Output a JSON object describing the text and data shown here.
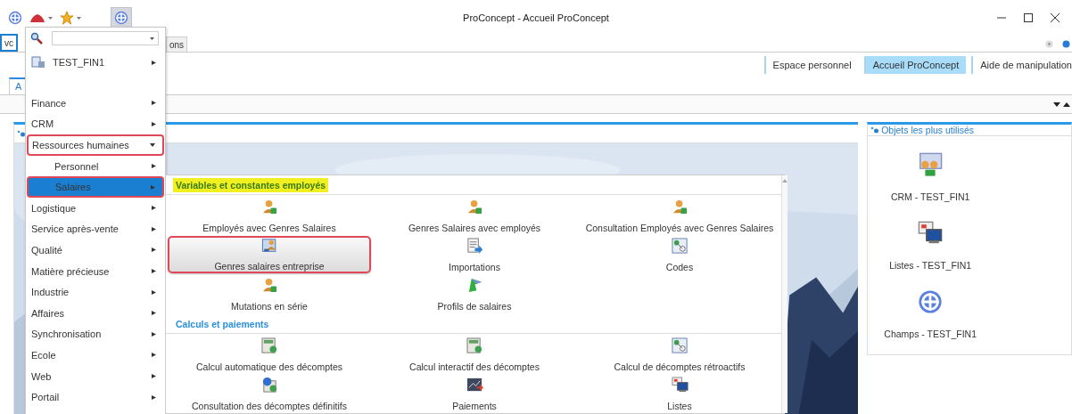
{
  "window": {
    "title": "ProConcept - Accueil ProConcept"
  },
  "document_tabs": [
    {
      "label": "vc",
      "selected": true
    },
    {
      "label": "ons",
      "selected": false
    }
  ],
  "nav_tabs": [
    {
      "label": "Espace personnel",
      "selected": false
    },
    {
      "label": "Accueil ProConcept",
      "selected": true
    },
    {
      "label": "Aide de manipulation",
      "selected": false
    }
  ],
  "page_tabs": [
    {
      "label": "A",
      "selected": true
    }
  ],
  "menu": {
    "workspace": {
      "label": "TEST_FIN1"
    },
    "items": [
      {
        "label": "Finance",
        "expanded": false,
        "selected": false,
        "outlined": false
      },
      {
        "label": "CRM",
        "expanded": false,
        "selected": false,
        "outlined": false
      },
      {
        "label": "Ressources humaines",
        "expanded": true,
        "selected": false,
        "outlined": true,
        "children": [
          {
            "label": "Personnel",
            "expanded": false,
            "selected": false,
            "outlined": false
          },
          {
            "label": "Salaires",
            "expanded": false,
            "selected": true,
            "outlined": true
          }
        ]
      },
      {
        "label": "Logistique",
        "expanded": false,
        "selected": false,
        "outlined": false
      },
      {
        "label": "Service après-vente",
        "expanded": false,
        "selected": false,
        "outlined": false
      },
      {
        "label": "Qualité",
        "expanded": false,
        "selected": false,
        "outlined": false
      },
      {
        "label": "Matière précieuse",
        "expanded": false,
        "selected": false,
        "outlined": false
      },
      {
        "label": "Industrie",
        "expanded": false,
        "selected": false,
        "outlined": false
      },
      {
        "label": "Affaires",
        "expanded": false,
        "selected": false,
        "outlined": false
      },
      {
        "label": "Synchronisation",
        "expanded": false,
        "selected": false,
        "outlined": false
      },
      {
        "label": "Ecole",
        "expanded": false,
        "selected": false,
        "outlined": false
      },
      {
        "label": "Web",
        "expanded": false,
        "selected": false,
        "outlined": false
      },
      {
        "label": "Portail",
        "expanded": false,
        "selected": false,
        "outlined": false
      }
    ]
  },
  "flyout": {
    "sections": [
      {
        "title": "Variables et constantes employés",
        "highlighted": true,
        "items": [
          {
            "label": "Employés avec Genres Salaires",
            "outlined": false
          },
          {
            "label": "Genres Salaires avec employés",
            "outlined": false
          },
          {
            "label": "Consultation Employés avec Genres Salaires",
            "outlined": false
          },
          {
            "label": "Genres salaires entreprise",
            "outlined": true
          },
          {
            "label": "Importations",
            "outlined": false
          },
          {
            "label": "Codes",
            "outlined": false
          },
          {
            "label": "Mutations en série",
            "outlined": false
          },
          {
            "label": "Profils de salaires",
            "outlined": false
          }
        ]
      },
      {
        "title": "Calculs et paiements",
        "highlighted": false,
        "items": [
          {
            "label": "Calcul automatique des décomptes",
            "outlined": false
          },
          {
            "label": "Calcul interactif des décomptes",
            "outlined": false
          },
          {
            "label": "Calcul de décomptes rétroactifs",
            "outlined": false
          },
          {
            "label": "Consultation des décomptes définitifs",
            "outlined": false
          },
          {
            "label": "Paiements",
            "outlined": false
          },
          {
            "label": "Listes",
            "outlined": false
          }
        ]
      }
    ]
  },
  "right_panel": {
    "title": "Objets les plus utilisés",
    "items": [
      {
        "label": "CRM - TEST_FIN1"
      },
      {
        "label": "Listes - TEST_FIN1"
      },
      {
        "label": "Champs - TEST_FIN1"
      }
    ]
  }
}
